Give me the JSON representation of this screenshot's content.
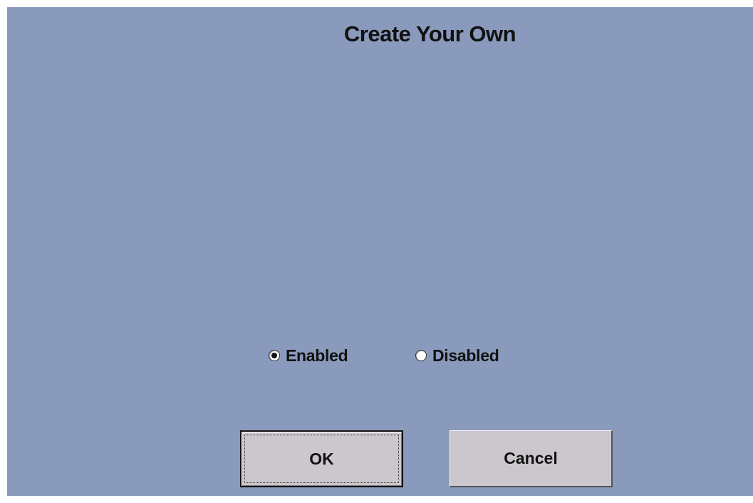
{
  "dialog": {
    "title": "Create Your Own",
    "background_color": "#8a9abd"
  },
  "radio_group": {
    "selected": "enabled",
    "options": [
      {
        "id": "enabled",
        "label": "Enabled",
        "checked": true
      },
      {
        "id": "disabled",
        "label": "Disabled",
        "checked": false
      }
    ]
  },
  "buttons": {
    "ok_label": "OK",
    "cancel_label": "Cancel",
    "button_color": "#cbc7cc"
  }
}
